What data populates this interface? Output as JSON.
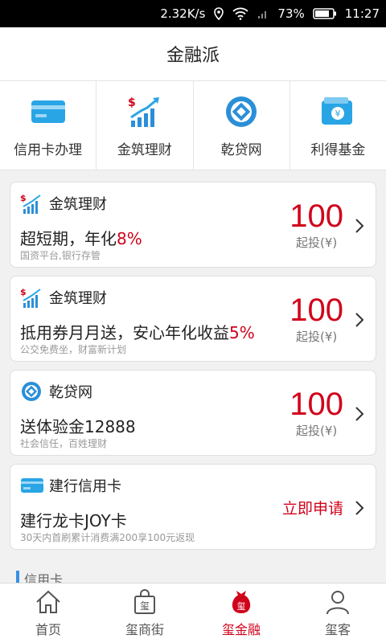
{
  "status": {
    "speed": "2.32K/s",
    "battery": "73%",
    "time": "11:27"
  },
  "header": {
    "title": "金融派"
  },
  "quick": [
    {
      "label": "信用卡办理",
      "icon": "credit-card-icon"
    },
    {
      "label": "金筑理财",
      "icon": "finance-chart-icon"
    },
    {
      "label": "乾贷网",
      "icon": "qiandai-logo-icon"
    },
    {
      "label": "利得基金",
      "icon": "wallet-icon"
    }
  ],
  "cards": [
    {
      "name": "金筑理财",
      "main": "超短期，年化",
      "highlight": "8%",
      "sub": "国资平台,银行存管",
      "amount": "100",
      "unit": "起投(¥)"
    },
    {
      "name": "金筑理财",
      "main": "抵用券月月送，安心年化收益",
      "highlight": "5%",
      "sub": "公交免费坐，财富新计划",
      "amount": "100",
      "unit": "起投(¥)"
    },
    {
      "name": "乾贷网",
      "main": "送体验金12888",
      "highlight": "",
      "sub": "社会信任，百姓理财",
      "amount": "100",
      "unit": "起投(¥)"
    },
    {
      "name": "建行信用卡",
      "main": "建行龙卡JOY卡",
      "highlight": "",
      "sub": "30天内首刷累计消费满200享100元返现",
      "action": "立即申请"
    }
  ],
  "section": {
    "label": "信用卡"
  },
  "tabs": [
    {
      "label": "首页",
      "icon": "home-icon"
    },
    {
      "label": "玺商街",
      "icon": "shopping-bag-icon"
    },
    {
      "label": "玺金融",
      "icon": "money-bag-icon",
      "active": true
    },
    {
      "label": "玺客",
      "icon": "person-icon"
    }
  ],
  "colors": {
    "accent": "#d0021b",
    "blue": "#3a8ee6"
  }
}
